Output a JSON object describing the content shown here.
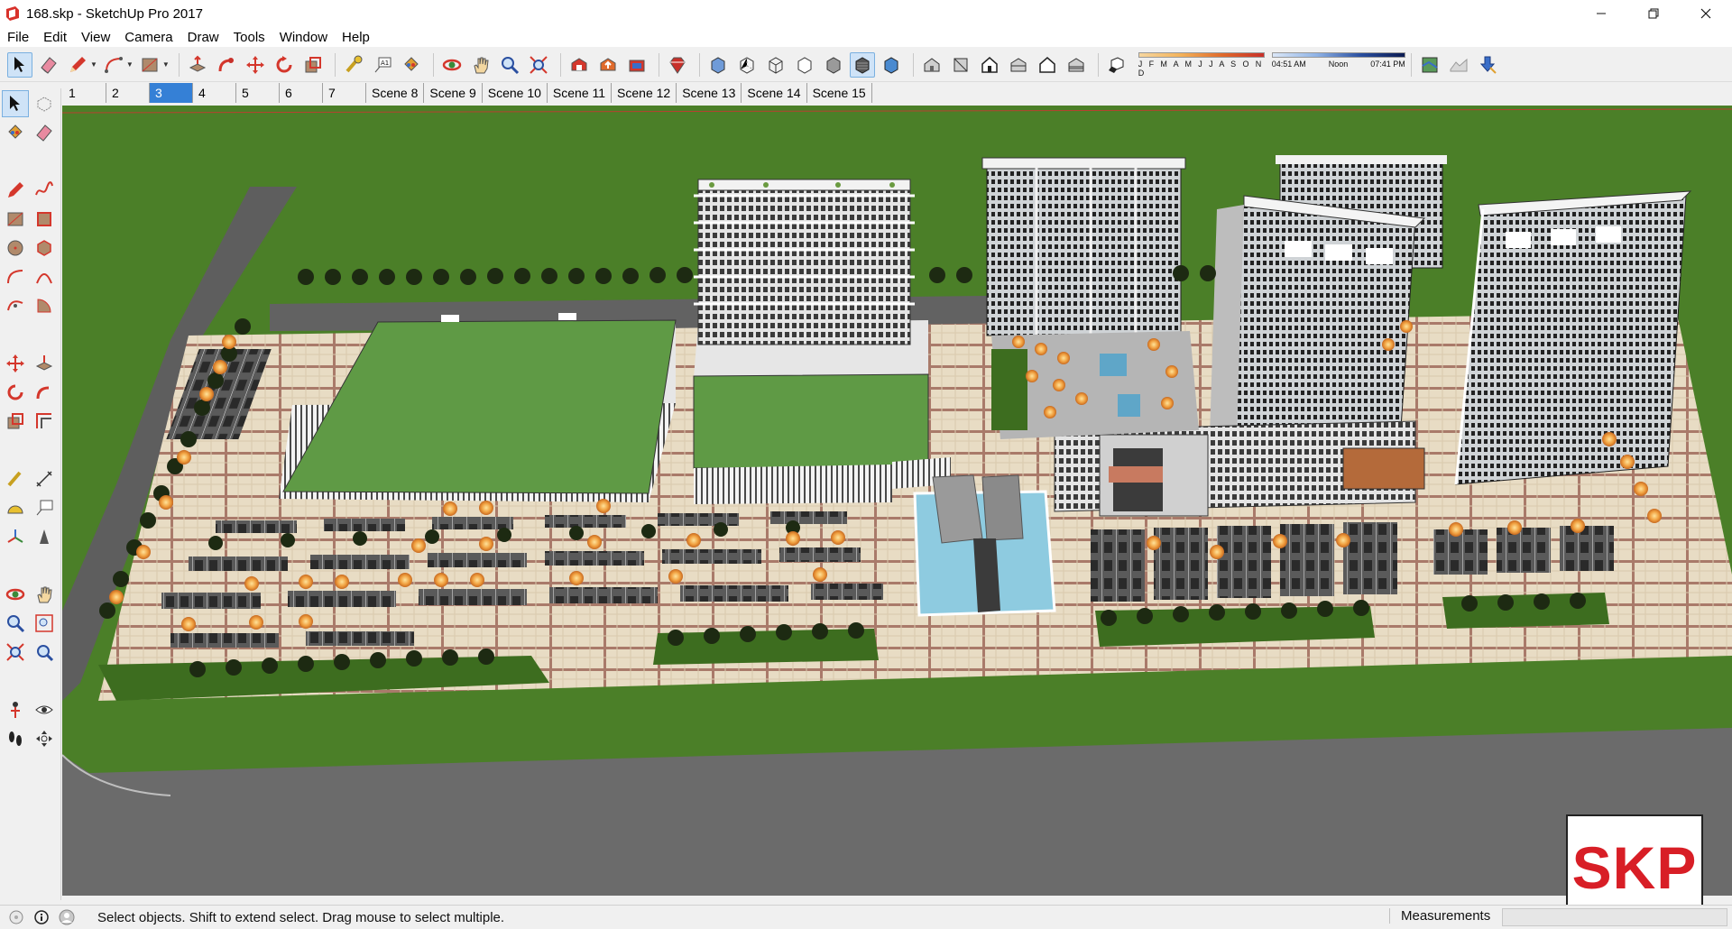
{
  "window": {
    "title": "168.skp - SketchUp Pro 2017",
    "minimize_icon": "minimize-icon",
    "maximize_icon": "restore-icon",
    "close_icon": "close-icon"
  },
  "menu": [
    {
      "label": "File"
    },
    {
      "label": "Edit"
    },
    {
      "label": "View"
    },
    {
      "label": "Camera"
    },
    {
      "label": "Draw"
    },
    {
      "label": "Tools"
    },
    {
      "label": "Window"
    },
    {
      "label": "Help"
    }
  ],
  "shadow": {
    "months": "J F M A M J J A S O N D",
    "time_start": "04:51 AM",
    "time_mid": "Noon",
    "time_end": "07:41 PM"
  },
  "scenes": [
    {
      "label": "1"
    },
    {
      "label": "2"
    },
    {
      "label": "3",
      "active": true
    },
    {
      "label": "4"
    },
    {
      "label": "5"
    },
    {
      "label": "6"
    },
    {
      "label": "7"
    },
    {
      "label": "Scene 8"
    },
    {
      "label": "Scene 9"
    },
    {
      "label": "Scene 10"
    },
    {
      "label": "Scene 11"
    },
    {
      "label": "Scene 12"
    },
    {
      "label": "Scene 13"
    },
    {
      "label": "Scene 14"
    },
    {
      "label": "Scene 15"
    }
  ],
  "status": {
    "hint": "Select objects. Shift to extend select. Drag mouse to select multiple.",
    "measurements_label": "Measurements",
    "measurements_value": ""
  },
  "watermark": {
    "text": "SKP"
  },
  "colors": {
    "ground": "#4b7f28",
    "plaza": "#e8dcc4",
    "road": "#6b6b6b",
    "roof_green": "#5f9a45",
    "building": "#d8d8d8",
    "accent_blue": "#3580d6",
    "watermark_red": "#d81e26"
  }
}
